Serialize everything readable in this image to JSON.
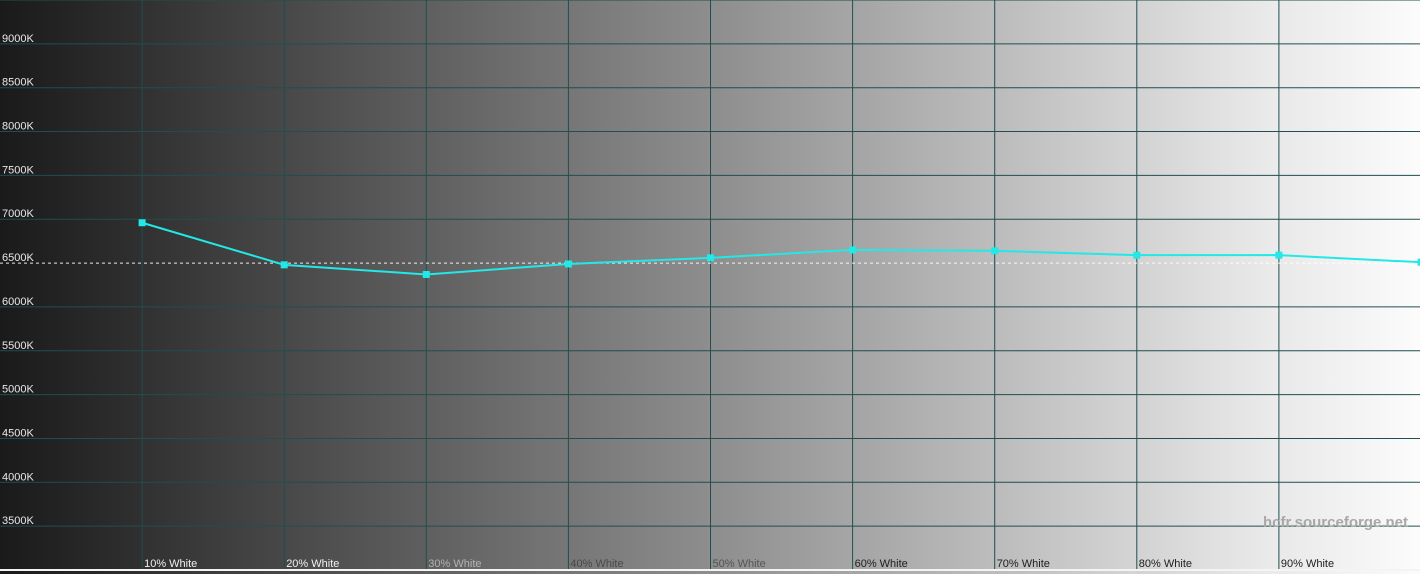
{
  "chart_data": {
    "type": "line",
    "title": "",
    "xlabel": "",
    "ylabel": "",
    "ylim": [
      3000,
      9500
    ],
    "yticks": [
      3500,
      4000,
      4500,
      5000,
      5500,
      6000,
      6500,
      7000,
      7500,
      8000,
      8500,
      9000
    ],
    "ytick_labels": [
      "3500K",
      "4000K",
      "4500K",
      "5000K",
      "5500K",
      "6000K",
      "6500K",
      "7000K",
      "7500K",
      "8000K",
      "8500K",
      "9000K"
    ],
    "categories": [
      "",
      "10% White",
      "20% White",
      "30% White",
      "40% White",
      "50% White",
      "60% White",
      "70% White",
      "80% White",
      "90% White",
      ""
    ],
    "reference_line": 6500,
    "series": [
      {
        "values": [
          null,
          6960,
          6480,
          6370,
          6490,
          6560,
          6650,
          6640,
          6590,
          6590,
          6510
        ],
        "color": "#22e8e8"
      }
    ],
    "grid": true,
    "background": "grayscale gradient, black to white"
  },
  "watermark": "hcfr.sourceforge.net",
  "colors": {
    "grid": "#1f4f4f",
    "series": "#22e8e8",
    "reference": "#ffffff"
  }
}
